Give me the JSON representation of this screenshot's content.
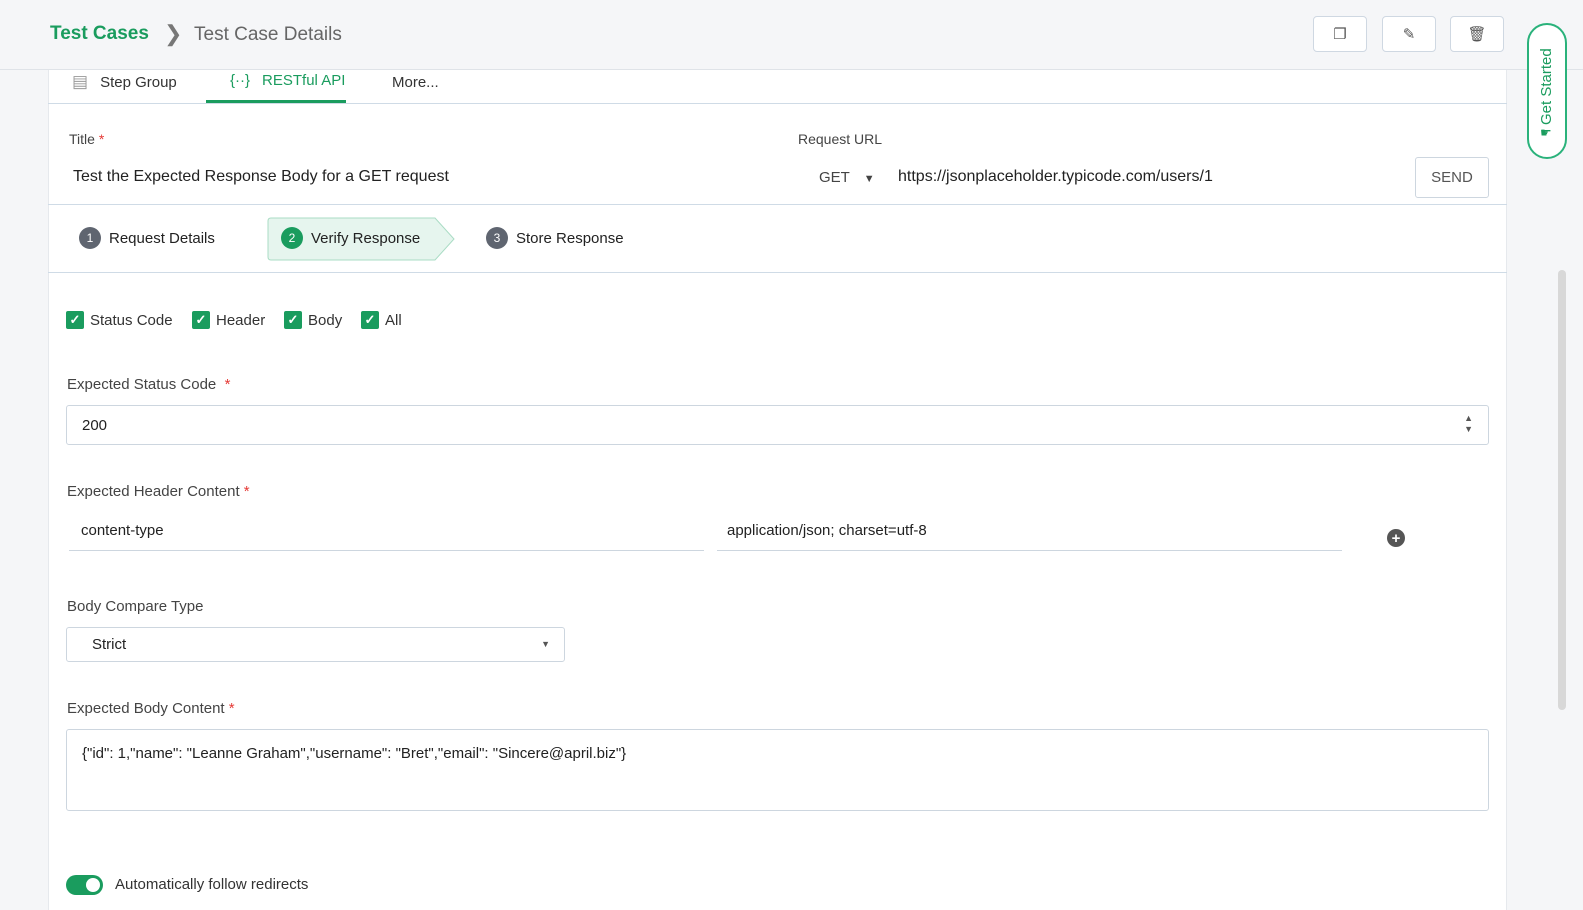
{
  "breadcrumb": {
    "root": "Test Cases",
    "current": "Test Case Details"
  },
  "toolbar": {
    "icons": [
      "copy-icon",
      "edit-icon",
      "delete-icon"
    ]
  },
  "get_started": "Get Started",
  "tabs": [
    {
      "label": "Step Group"
    },
    {
      "label": "RESTful API",
      "active": true
    },
    {
      "label": "More..."
    }
  ],
  "form": {
    "title_label": "Title",
    "title_value": "Test the Expected Response Body for a GET request",
    "url_label": "Request URL",
    "method": "GET",
    "url": "https://jsonplaceholder.typicode.com/users/1",
    "send": "SEND"
  },
  "steps": [
    {
      "num": "1",
      "label": "Request Details"
    },
    {
      "num": "2",
      "label": "Verify Response",
      "active": true
    },
    {
      "num": "3",
      "label": "Store Response"
    }
  ],
  "checks": [
    {
      "label": "Status Code",
      "checked": true
    },
    {
      "label": "Header",
      "checked": true
    },
    {
      "label": "Body",
      "checked": true
    },
    {
      "label": "All",
      "checked": true
    }
  ],
  "status": {
    "label": "Expected Status Code",
    "value": "200"
  },
  "header": {
    "label": "Expected Header Content",
    "key": "content-type",
    "value": "application/json; charset=utf-8"
  },
  "compare": {
    "label": "Body Compare Type",
    "value": "Strict"
  },
  "body": {
    "label": "Expected Body Content",
    "value": "{\"id\": 1,\"name\": \"Leanne Graham\",\"username\": \"Bret\",\"email\": \"Sincere@april.biz\"}"
  },
  "redirect": {
    "label": "Automatically follow redirects",
    "on": true
  },
  "colors": {
    "accent": "#1a9c5e"
  }
}
